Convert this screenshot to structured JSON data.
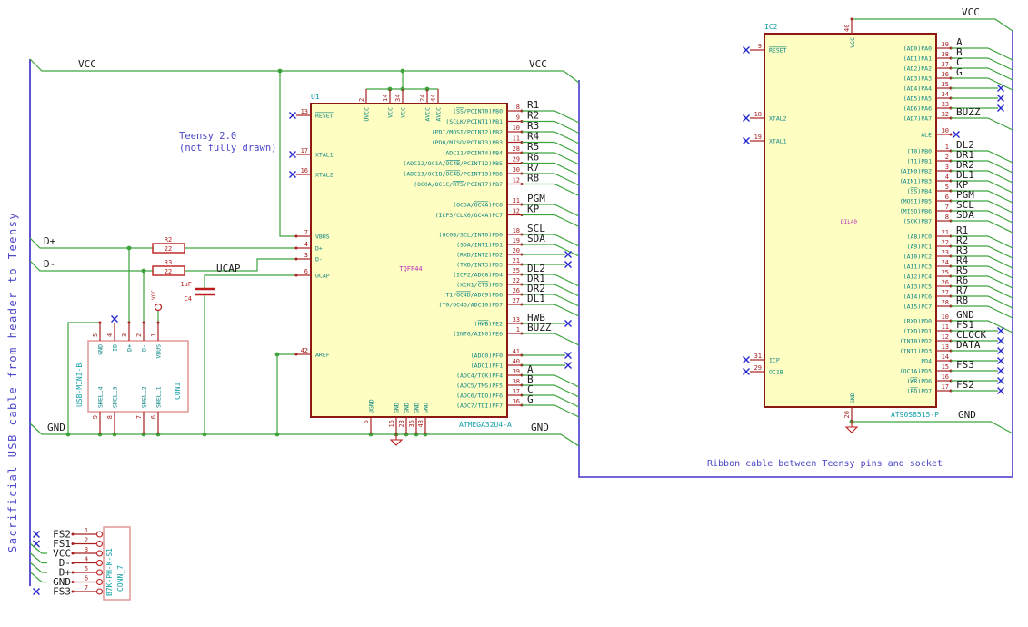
{
  "notes": {
    "teensy": [
      "Teensy 2.0",
      "(not fully drawn)"
    ],
    "usb_cable": "Sacrificial USB cable from header to Teensy",
    "ribbon": "Ribbon cable between Teensy pins and socket"
  },
  "power_labels": {
    "vcc_left": "VCC",
    "vcc_right_u1": "VCC",
    "gnd_left": "GND",
    "gnd_right_u1": "GND",
    "vcc_ic2": "VCC",
    "gnd_ic2": "GND",
    "vcc_symbol": "VCC"
  },
  "net_labels_left": {
    "dplus": "D+",
    "dminus": "D-",
    "ucap": "UCAP"
  },
  "u1": {
    "ref": "U1",
    "part": "ATMEGA32U4-A",
    "package": "TQFP44",
    "top_pins": [
      {
        "name": "UVCC",
        "num": "2"
      },
      {
        "name": "VCC",
        "num": "14"
      },
      {
        "name": "VCC",
        "num": "34"
      },
      {
        "name": "AVCC",
        "num": "24"
      },
      {
        "name": "AVCC",
        "num": "44"
      }
    ],
    "bottom_pins": [
      {
        "name": "UGND",
        "num": "5"
      },
      {
        "name": "GND",
        "num": "15"
      },
      {
        "name": "GND",
        "num": "23"
      },
      {
        "name": "GND",
        "num": "35"
      },
      {
        "name": "GND",
        "num": "43"
      }
    ],
    "left_pins": [
      {
        "name": "~RESET~",
        "num": "13",
        "conn": "nc"
      },
      {
        "name": "XTAL1",
        "num": "17",
        "conn": "nc"
      },
      {
        "name": "XTAL2",
        "num": "16",
        "conn": "nc"
      },
      {
        "name": "VBUS",
        "num": "7",
        "conn": "wire"
      },
      {
        "name": "D+",
        "num": "4",
        "conn": "wire"
      },
      {
        "name": "D-",
        "num": "3",
        "conn": "wire"
      },
      {
        "name": "UCAP",
        "num": "6",
        "conn": "wire"
      },
      {
        "name": "AREF",
        "num": "42",
        "conn": "wire"
      }
    ],
    "right_groups": [
      [
        {
          "name": "(~SS~/PCINT0)PB0",
          "num": "8",
          "net": "R1"
        },
        {
          "name": "(SCLK/PCINT1)PB1",
          "num": "9",
          "net": "R2"
        },
        {
          "name": "(PDI/MOSI/PCINT2)PB2",
          "num": "10",
          "net": "R3"
        },
        {
          "name": "(PDO/MISO/PCINT3)PB3",
          "num": "11",
          "net": "R4"
        },
        {
          "name": "(ADC11/PCINT4)PB4",
          "num": "28",
          "net": "R5"
        },
        {
          "name": "(ADC12/OC1A/~OC4B~/PCINT12)PB5",
          "num": "29",
          "net": "R6"
        },
        {
          "name": "(ADC13/OC1B/~OC4B~/PCINT13)PB6",
          "num": "30",
          "net": "R7"
        },
        {
          "name": "(OC0A/OC1C/~RTS~/PCINT7)PB7",
          "num": "12",
          "net": "R8"
        }
      ],
      [
        {
          "name": "(OC3A/~OC4A~)PC6",
          "num": "31",
          "net": "PGM"
        },
        {
          "name": "(ICP3/CLK0/OC4A)PC7",
          "num": "32",
          "net": "KP"
        }
      ],
      [
        {
          "name": "(OC0B/SCL/INT0)PD0",
          "num": "18",
          "net": "SCL"
        },
        {
          "name": "(SDA/INT1)PD1",
          "num": "19",
          "net": "SDA"
        },
        {
          "name": "(RXD/INT2)PD2",
          "num": "20",
          "nc": true
        },
        {
          "name": "(TXD/INT3)PD3",
          "num": "21",
          "nc": true
        },
        {
          "name": "(ICP2/ADC8)PD4",
          "num": "25",
          "net": "DL2"
        },
        {
          "name": "(XCK1/~CTS~)PD5",
          "num": "22",
          "net": "DR1"
        },
        {
          "name": "(T1/~OC4D~/ADC9)PD6",
          "num": "26",
          "net": "DR2"
        },
        {
          "name": "(T0/OC4D/ADC10)PD7",
          "num": "27",
          "net": "DL1"
        }
      ],
      [
        {
          "name": "(~HWB~)PE2",
          "num": "33",
          "net": "HWB",
          "nc": true
        },
        {
          "name": "(INT6/AIN0)PE6",
          "num": "1",
          "net": "BUZZ"
        }
      ],
      [
        {
          "name": "(ADC0)PF0",
          "num": "41",
          "nc": true
        },
        {
          "name": "(ADC1)PF1",
          "num": "40",
          "nc": true
        },
        {
          "name": "(ADC4/TCK)PF4",
          "num": "39",
          "net": "A"
        },
        {
          "name": "(ADC5/TMS)PF5",
          "num": "38",
          "net": "B"
        },
        {
          "name": "(ADC6/TDO)PF6",
          "num": "37",
          "net": "C"
        },
        {
          "name": "(ADC7/TDI)PF7",
          "num": "36",
          "net": "G"
        }
      ]
    ]
  },
  "r2": {
    "ref": "R2",
    "value": "22"
  },
  "r3": {
    "ref": "R3",
    "value": "22"
  },
  "c4": {
    "ref": "C4",
    "value": "1uF"
  },
  "usb": {
    "ref": "CON1",
    "part": "USB-MINI-B",
    "top_pins": [
      {
        "name": "GND",
        "num": "5"
      },
      {
        "name": "ID",
        "num": "4"
      },
      {
        "name": "D+",
        "num": "3"
      },
      {
        "name": "D-",
        "num": "2"
      },
      {
        "name": "VBUS",
        "num": "1"
      }
    ],
    "bottom_pins": [
      {
        "name": "SHELL4",
        "num": "9"
      },
      {
        "name": "SHELL3",
        "num": "8"
      },
      {
        "name": "SHELL2",
        "num": "7"
      },
      {
        "name": "SHELL1",
        "num": "6"
      }
    ]
  },
  "conn7": {
    "ref": "CONN_7",
    "part": "B7K-PH-K-S1",
    "pins": [
      {
        "num": "1",
        "net": "FS2",
        "conn": "nc"
      },
      {
        "num": "2",
        "net": "FS1",
        "conn": "nc"
      },
      {
        "num": "3",
        "net": "VCC",
        "conn": "wire"
      },
      {
        "num": "4",
        "net": "D-",
        "conn": "wire"
      },
      {
        "num": "5",
        "net": "D+",
        "conn": "wire"
      },
      {
        "num": "6",
        "net": "GND",
        "conn": "wire"
      },
      {
        "num": "7",
        "net": "FS3",
        "conn": "nc"
      }
    ]
  },
  "ic2": {
    "ref": "IC2",
    "part": "AT90S8515-P",
    "package": "DIL40",
    "top_pins": [
      {
        "name": "VCC",
        "num": "40"
      }
    ],
    "bottom_pins": [
      {
        "name": "GND",
        "num": "20"
      }
    ],
    "left_pins": [
      {
        "name": "~RESET~",
        "num": "9",
        "conn": "nc"
      },
      {
        "name": "XTAL2",
        "num": "18",
        "conn": "nc"
      },
      {
        "name": "XTAL1",
        "num": "19",
        "conn": "nc"
      },
      {
        "name": "ICP",
        "num": "31",
        "conn": "nc"
      },
      {
        "name": "OC1B",
        "num": "29",
        "conn": "nc"
      }
    ],
    "right_groups": [
      [
        {
          "name": "(AD0)PA0",
          "num": "39",
          "net": "A"
        },
        {
          "name": "(AD1)PA1",
          "num": "38",
          "net": "B"
        },
        {
          "name": "(AD2)PA2",
          "num": "37",
          "net": "C"
        },
        {
          "name": "(AD3)PA3",
          "num": "36",
          "net": "G"
        },
        {
          "name": "(AD4)PA4",
          "num": "35",
          "nc": true
        },
        {
          "name": "(AD5)PA5",
          "num": "34",
          "nc": true
        },
        {
          "name": "(AD6)PA6",
          "num": "33",
          "nc": true
        },
        {
          "name": "(AD7)PA7",
          "num": "32",
          "net": "BUZZ"
        }
      ],
      [
        {
          "name": "ALE",
          "num": "30",
          "nc": true,
          "nc_near": true
        }
      ],
      [
        {
          "name": "(T0)PB0",
          "num": "1",
          "net": "DL2"
        },
        {
          "name": "(T1)PB1",
          "num": "2",
          "net": "DR1"
        },
        {
          "name": "(AIN0)PB2",
          "num": "3",
          "net": "DR2"
        },
        {
          "name": "(AIN1)PB3",
          "num": "4",
          "net": "DL1"
        },
        {
          "name": "(~SS~)PB4",
          "num": "5",
          "net": "KP"
        },
        {
          "name": "(MOSI)PB5",
          "num": "6",
          "net": "PGM"
        },
        {
          "name": "(MISO)PB6",
          "num": "7",
          "net": "SCL"
        },
        {
          "name": "(SCK)PB7",
          "num": "8",
          "net": "SDA"
        }
      ],
      [
        {
          "name": "(A8)PC0",
          "num": "21",
          "net": "R1"
        },
        {
          "name": "(A9)PC1",
          "num": "22",
          "net": "R2"
        },
        {
          "name": "(A10)PC2",
          "num": "23",
          "net": "R3"
        },
        {
          "name": "(A11)PC3",
          "num": "24",
          "net": "R4"
        },
        {
          "name": "(A12)PC4",
          "num": "25",
          "net": "R5"
        },
        {
          "name": "(A13)PC5",
          "num": "26",
          "net": "R6"
        },
        {
          "name": "(A14)PC6",
          "num": "27",
          "net": "R7"
        },
        {
          "name": "(A15)PC7",
          "num": "28",
          "net": "R8"
        }
      ],
      [
        {
          "name": "(RXD)PD0",
          "num": "10",
          "net": "GND"
        },
        {
          "name": "(TXD)PD1",
          "num": "11",
          "net": "FS1",
          "nc": true
        },
        {
          "name": "(INT0)PD2",
          "num": "12",
          "net": "CLOCK",
          "nc": true
        },
        {
          "name": "(INT1)PD3",
          "num": "13",
          "net": "DATA",
          "nc": true
        },
        {
          "name": "PD4",
          "num": "14",
          "nc": true
        },
        {
          "name": "(OC1A)PD5",
          "num": "15",
          "net": "FS3",
          "nc": true
        },
        {
          "name": "(~WR~)PD6",
          "num": "16",
          "nc": true
        },
        {
          "name": "(~RD~)PD7",
          "num": "17",
          "net": "FS2",
          "nc": true
        }
      ]
    ]
  },
  "colors": {
    "wire": "#3da33d",
    "outline": "#8c1a13",
    "fill": "#fffec2",
    "pin_num": "#a82020",
    "pin_name": "#0b8484",
    "ref": "#12a0a8",
    "value_magenta": "#bb2fbb",
    "net_label": "#1b1b1b",
    "note": "#4c46c8",
    "frame": "#5d52d4",
    "no_connect": "#2626cc",
    "device_red": "#bb1c1c",
    "connector_outline": "#e09090"
  }
}
